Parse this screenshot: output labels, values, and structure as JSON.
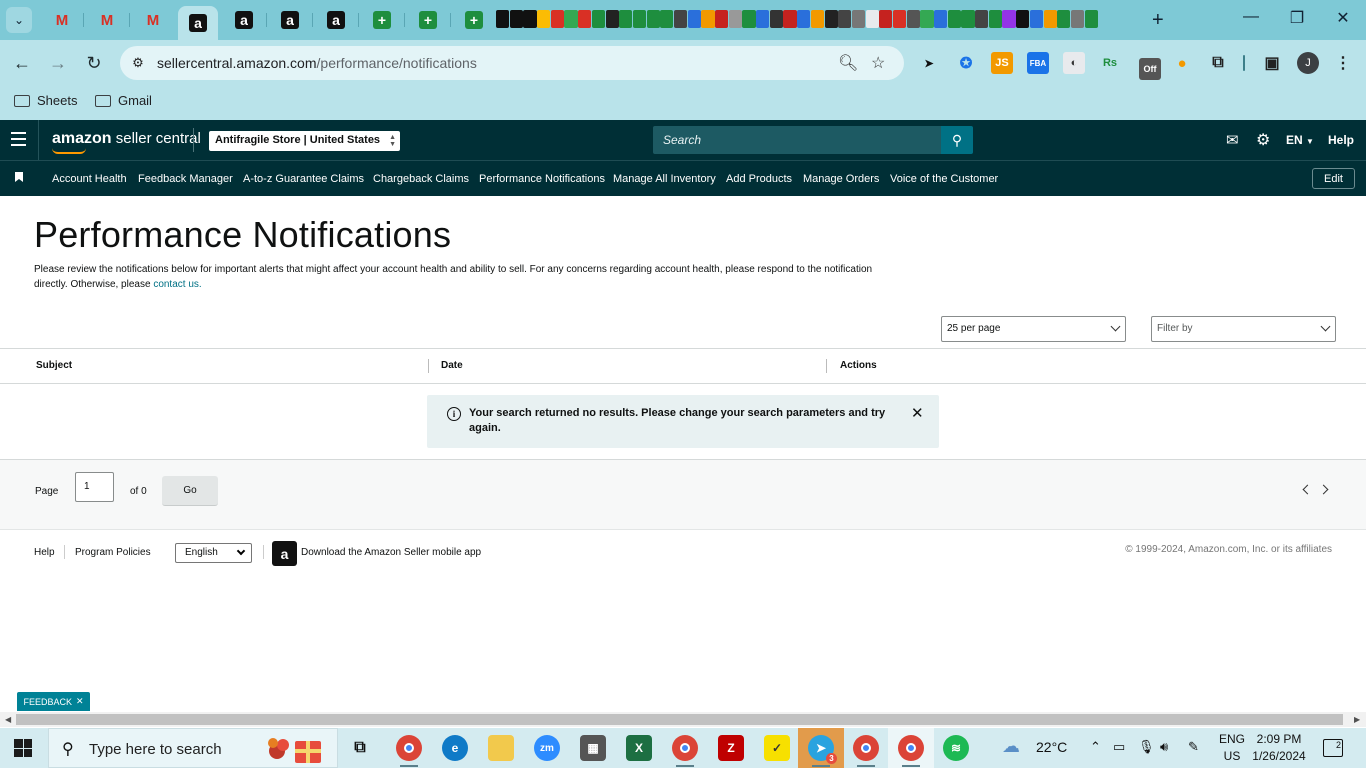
{
  "browser": {
    "url_host": "sellercentral.amazon.com",
    "url_path": "/performance/notifications",
    "bookmarks": [
      "Sheets",
      "Gmail"
    ],
    "profile_initial": "J",
    "new_tab_label": "+",
    "ext_js_label": "JS",
    "ext_rs_label": "Rs",
    "ext_off_label": "Off"
  },
  "header": {
    "logo_brand": "amazon",
    "logo_suffix": "seller central",
    "store_selector": "Antifragile Store | United States",
    "search_placeholder": "Search",
    "language": "EN",
    "help_label": "Help"
  },
  "nav": {
    "items": [
      "Account Health",
      "Feedback Manager",
      "A-to-z Guarantee Claims",
      "Chargeback Claims",
      "Performance Notifications",
      "Manage All Inventory",
      "Add Products",
      "Manage Orders",
      "Voice of the Customer"
    ],
    "edit_label": "Edit"
  },
  "page": {
    "title": "Performance Notifications",
    "description": "Please review the notifications below for important alerts that might affect your account health and ability to sell. For any concerns regarding account health, please respond to the notification directly. Otherwise, please",
    "contact_link": "contact us.",
    "per_page": "25 per page",
    "filter_placeholder": "Filter by"
  },
  "table": {
    "columns": [
      "Subject",
      "Date",
      "Actions"
    ],
    "empty_message": "Your search returned no results. Please change your search parameters and try again."
  },
  "pagination": {
    "page_label": "Page",
    "current_page": "1",
    "of_label": "of 0",
    "go_label": "Go"
  },
  "footer": {
    "help": "Help",
    "program_policies": "Program Policies",
    "language": "English",
    "app_download": "Download the Amazon Seller mobile app",
    "copyright": "© 1999-2024, Amazon.com, Inc. or its affiliates"
  },
  "feedback_tab": "FEEDBACK",
  "taskbar": {
    "search_placeholder": "Type here to search",
    "weather": "22°C",
    "lang_line1": "ENG",
    "lang_line2": "US",
    "time": "2:09 PM",
    "date": "1/26/2024",
    "notifications_count": "2",
    "zoom_label": "zm",
    "telegram_badge": "3"
  },
  "colors": {
    "tabstrip": "#7ec9d6",
    "header_bg": "#002f36",
    "search_button": "#007185",
    "alert_bg": "#e8f1f2",
    "feedback_bg": "#008296",
    "link": "#007185"
  }
}
